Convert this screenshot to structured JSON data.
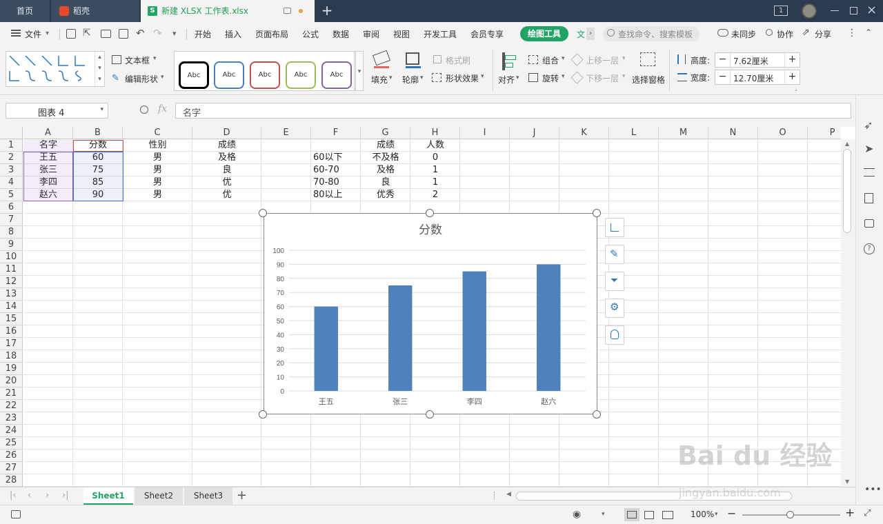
{
  "tabs": {
    "home": "首页",
    "daoke": "稻壳",
    "doc": "新建 XLSX 工作表.xlsx",
    "window_count": "1"
  },
  "menu": {
    "file": "文件",
    "items": [
      "开始",
      "插入",
      "页面布局",
      "公式",
      "数据",
      "审阅",
      "视图",
      "开发工具",
      "会员专享"
    ],
    "drawing_tools": "绘图工具",
    "text_tab_partial": "文",
    "search_placeholder": "查找命令、搜索模板",
    "sync": "未同步",
    "collab": "协作",
    "share": "分享"
  },
  "ribbon": {
    "textbox": "文本框",
    "edit_shape": "编辑形状",
    "style_label": "Abc",
    "style_colors": [
      "#000000",
      "#4a7ebb",
      "#c0504d",
      "#9bbb59",
      "#8064a2"
    ],
    "fill": "填充",
    "outline": "轮廓",
    "format_painter": "格式刷",
    "shape_effect": "形状效果",
    "align": "对齐",
    "group": "组合",
    "rotate": "旋转",
    "bring_forward": "上移一层",
    "send_backward": "下移一层",
    "selection_pane": "选择窗格",
    "height_label": "高度:",
    "height_value": "7.62厘米",
    "width_label": "宽度:",
    "width_value": "12.70厘米"
  },
  "formula": {
    "name_box": "图表 4",
    "fx": "fx",
    "content": "名字"
  },
  "columns": [
    "A",
    "B",
    "C",
    "D",
    "E",
    "F",
    "G",
    "H",
    "I",
    "J",
    "K",
    "L",
    "M",
    "N",
    "O",
    "P"
  ],
  "rows": [
    "1",
    "2",
    "3",
    "4",
    "5",
    "6",
    "7",
    "8",
    "9",
    "10",
    "11",
    "12",
    "13",
    "14",
    "15",
    "16",
    "17",
    "18",
    "19",
    "20",
    "21",
    "22",
    "23",
    "24",
    "25",
    "26",
    "27",
    "28"
  ],
  "cells": {
    "A": [
      "名字",
      "王五",
      "张三",
      "李四",
      "赵六"
    ],
    "B": [
      "分数",
      "60",
      "75",
      "85",
      "90"
    ],
    "C": [
      "性别",
      "男",
      "男",
      "男",
      "男"
    ],
    "D": [
      "成绩",
      "及格",
      "良",
      "优",
      "优"
    ],
    "F": [
      "",
      "60以下",
      "60-70",
      "70-80",
      "80以上"
    ],
    "G": [
      "成绩",
      "不及格",
      "及格",
      "良",
      "优秀"
    ],
    "H": [
      "人数",
      "0",
      "1",
      "1",
      "2"
    ]
  },
  "chart_data": {
    "type": "bar",
    "title": "分数",
    "categories": [
      "王五",
      "张三",
      "李四",
      "赵六"
    ],
    "values": [
      60,
      75,
      85,
      90
    ],
    "ylim": [
      0,
      100
    ],
    "yticks": [
      "0",
      "10",
      "20",
      "30",
      "40",
      "50",
      "60",
      "70",
      "80",
      "90",
      "100"
    ],
    "grid": true,
    "bar_color": "#4f81bd"
  },
  "sheets": [
    "Sheet1",
    "Sheet2",
    "Sheet3"
  ],
  "status": {
    "zoom": "100%"
  },
  "watermark": {
    "brand": "Bai du 经验",
    "url": "jingyan.baidu.com"
  }
}
